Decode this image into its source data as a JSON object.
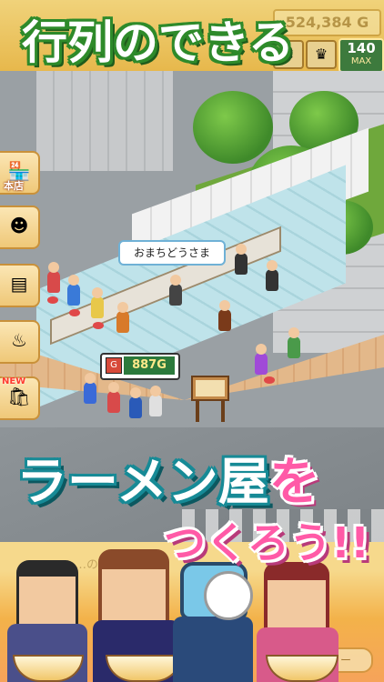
{
  "headline": {
    "top": "行列のできる",
    "mid_part1": "ラーメン屋",
    "mid_part2": "を",
    "bottom": "つくろう!!"
  },
  "status_bar": {
    "money": "524,384 G",
    "capacity_value": "140",
    "capacity_label": "MAX"
  },
  "shop": {
    "speech_bubble": "おまちどうさま",
    "price_amount": "887",
    "price_unit": "G"
  },
  "side_menu": {
    "items": [
      {
        "label": "本店",
        "icon": "storefront-icon"
      },
      {
        "label": "",
        "icon": "staff-icon"
      },
      {
        "label": "",
        "icon": "menu-board-icon"
      },
      {
        "label": "",
        "icon": "pot-icon"
      },
      {
        "label": "",
        "icon": "shopping-bag-icon",
        "badge": "NEW"
      }
    ]
  },
  "bottom_strip": {
    "label": "…のレベ",
    "button": "ー"
  },
  "colors": {
    "headline_top_outline": "#2e8a2a",
    "headline_mid_outline": "#178a96",
    "headline_pink": "#ff5aa7",
    "menu_bg": "#fbe6b4"
  }
}
